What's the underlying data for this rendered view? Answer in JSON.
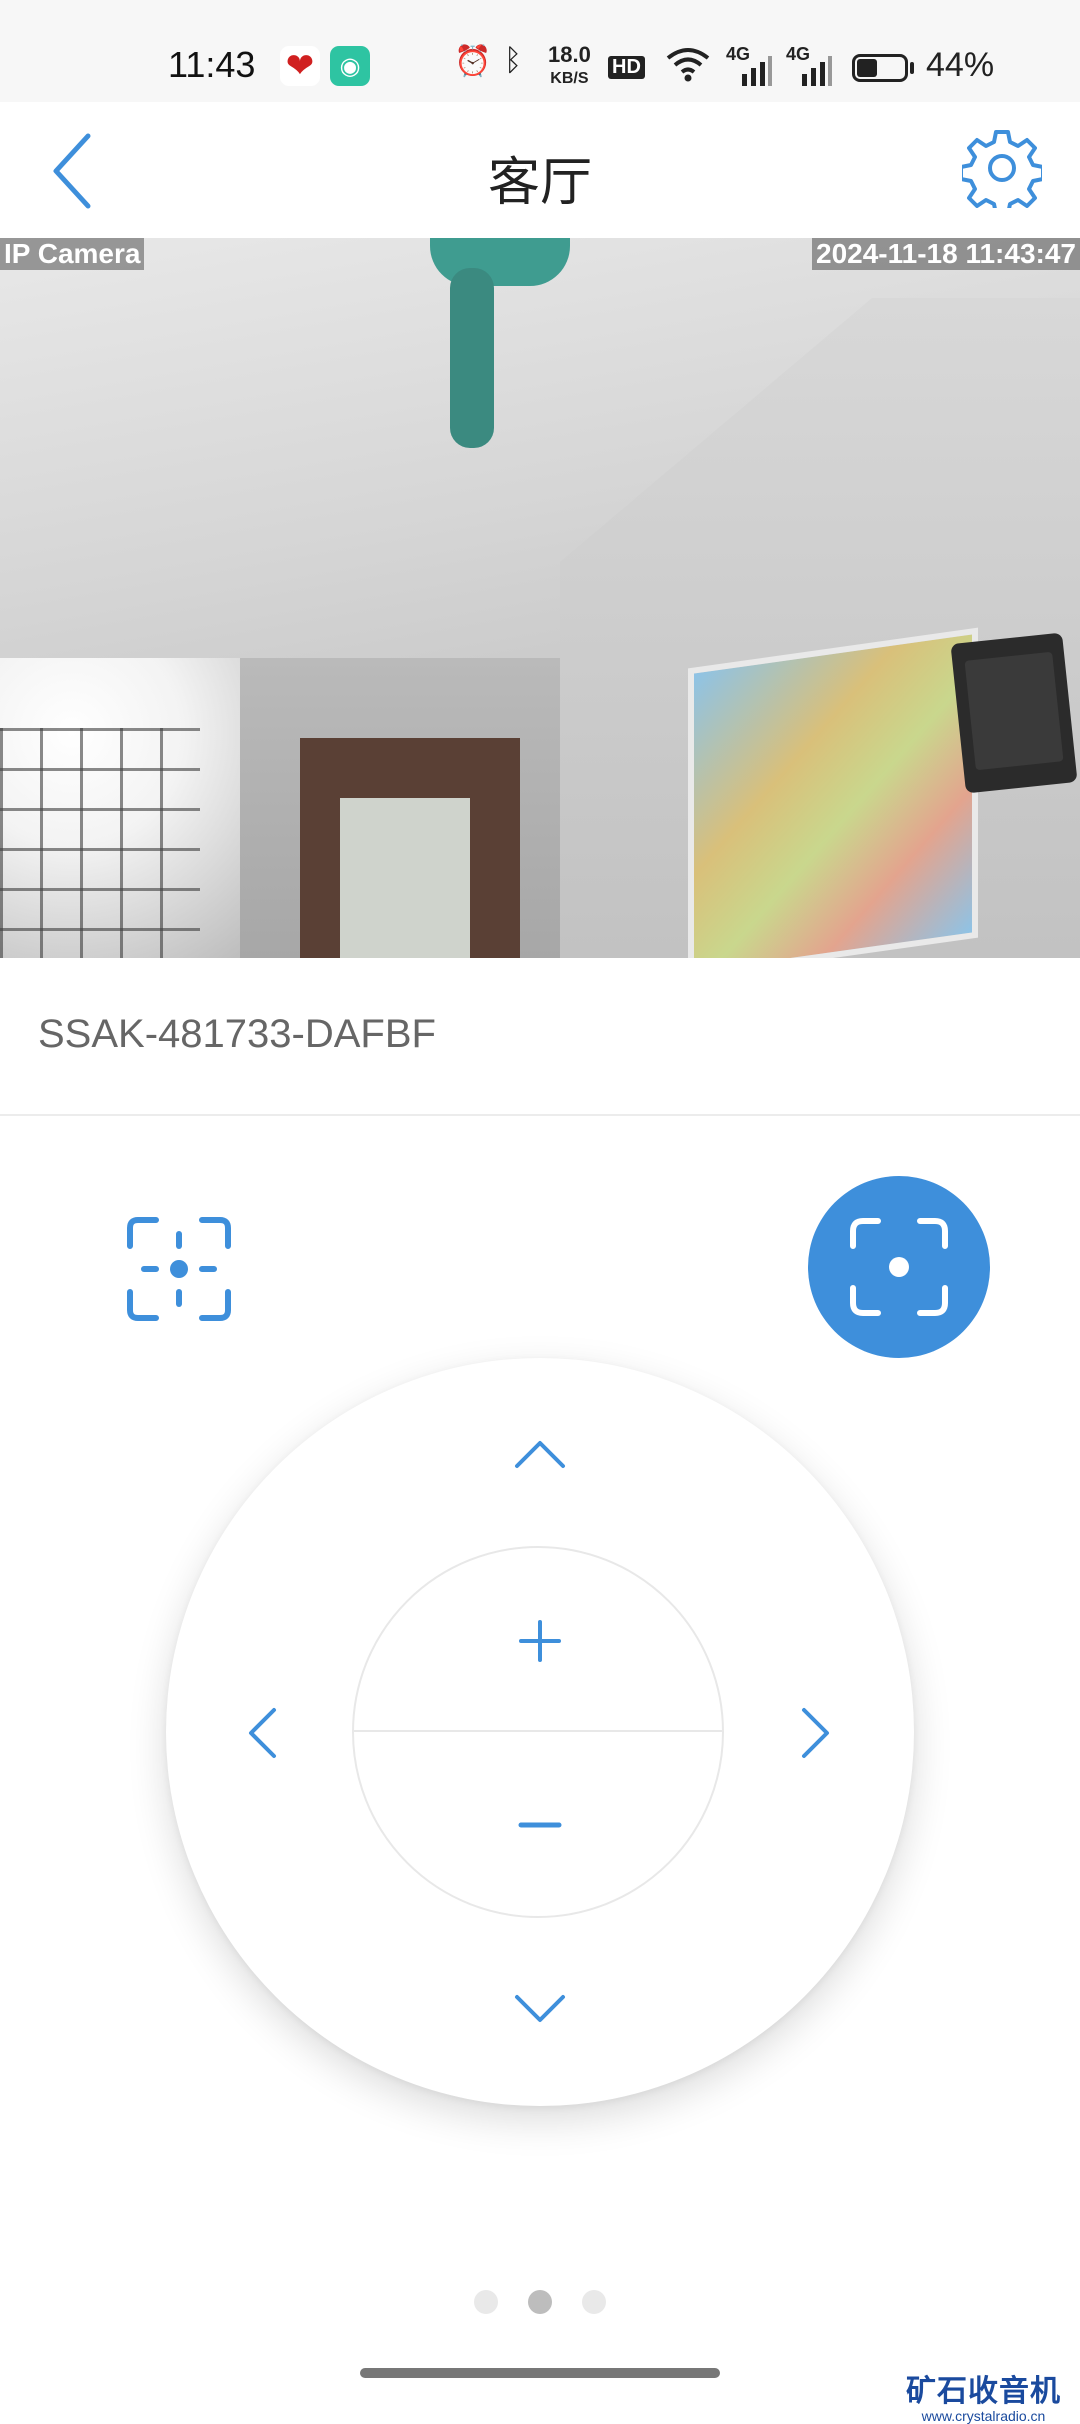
{
  "status_bar": {
    "time": "11:43",
    "speed_value": "18.0",
    "speed_unit": "KB/S",
    "hd_label": "HD",
    "network_1": "4G",
    "network_2": "4G",
    "battery_percent": "44%",
    "battery_level": 0.44
  },
  "header": {
    "title": "客厅",
    "back_icon": "chevron-left-icon",
    "settings_icon": "gear-icon"
  },
  "video": {
    "osd_camera_label": "IP Camera",
    "osd_timestamp": "2024-11-18 11:43:47"
  },
  "device": {
    "id": "SSAK-481733-DAFBF"
  },
  "controls": {
    "focus_icon": "focus-target-icon",
    "snapshot_icon": "scan-frame-icon"
  },
  "ptz": {
    "up_icon": "chevron-up-icon",
    "down_icon": "chevron-down-icon",
    "left_icon": "chevron-left-icon",
    "right_icon": "chevron-right-icon",
    "zoom_in_label": "+",
    "zoom_out_label": "−"
  },
  "pager": {
    "count": 3,
    "active_index": 2
  },
  "watermark": {
    "title": "矿石收音机",
    "url": "www.crystalradio.cn"
  },
  "colors": {
    "accent": "#3e8fdb",
    "text_gray": "#666666"
  }
}
